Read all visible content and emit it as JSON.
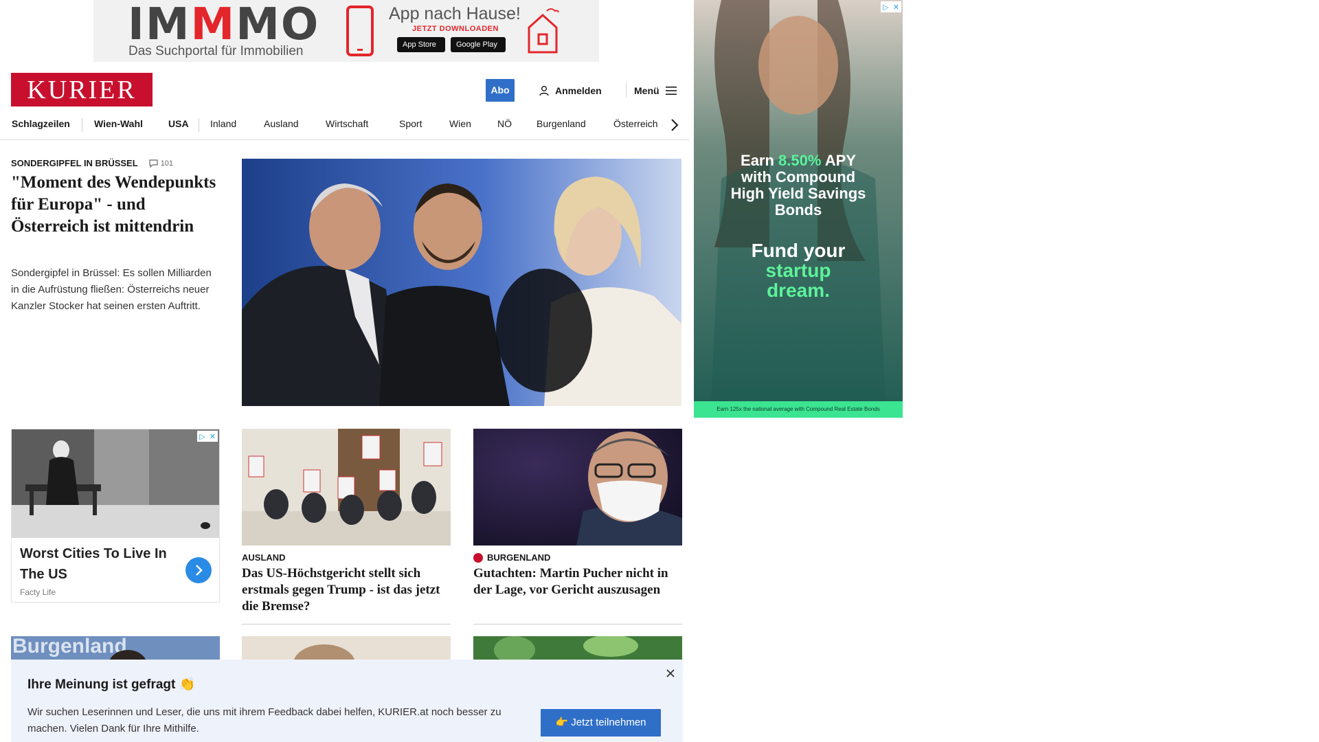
{
  "top_ad": {
    "brand_left": "IM",
    "brand_red": "M",
    "brand_right": "MO",
    "subtitle": "Das Suchportal für Immobilien",
    "claim": "App nach Hause!",
    "cta": "JETZT DOWNLOADEN",
    "store_apple": "App Store",
    "store_google": "Google Play"
  },
  "header": {
    "logo": "KURIER",
    "abo_label": "Abo",
    "login_label": "Anmelden",
    "menu_label": "Menü"
  },
  "nav": {
    "items": [
      "Schlagzeilen",
      "Wien-Wahl",
      "USA",
      "Inland",
      "Ausland",
      "Wirtschaft",
      "Sport",
      "Wien",
      "NÖ",
      "Burgenland",
      "Österreich"
    ]
  },
  "lead": {
    "kicker": "SONDERGIPFEL IN BRÜSSEL",
    "comments": "101",
    "title": "\"Moment des Wendepunkts für Europa\" - und Österreich ist mittendrin",
    "teaser": "Sondergipfel in Brüssel: Es sollen Milliarden in die Aufrüstung fließen: Österreichs neuer Kanzler Stocker hat seinen ersten Auftritt."
  },
  "native_ad": {
    "title": "Worst Cities To Live In The US",
    "source": "Facty Life"
  },
  "cards": [
    {
      "kicker": "AUSLAND",
      "title": "Das US-Höchstgericht stellt sich erstmals gegen Trump - ist das jetzt die Bremse?"
    },
    {
      "kicker": "BURGENLAND",
      "title": "Gutachten: Martin Pucher nicht in der Lage, vor Gericht auszusagen"
    }
  ],
  "thumb_text": "Burgenland",
  "side_ad": {
    "line1_a": "Earn ",
    "line1_green": "8.50%",
    "line1_b": " APY",
    "line2": "with Compound",
    "line3": "High Yield Savings",
    "line4": "Bonds",
    "fund_a": "Fund your",
    "fund_green_1": "startup",
    "fund_green_2": "dream.",
    "bar_text": "Earn 125x the national average with Compound Real Estate Bonds"
  },
  "survey": {
    "title": "Ihre Meinung ist gefragt 👏",
    "text": "Wir suchen Leserinnen und Leser, die uns mit ihrem Feedback dabei helfen, KURIER.at noch besser zu machen. Vielen Dank für Ihre Mithilfe.",
    "button": "👉 Jetzt teilnehmen"
  },
  "colors": {
    "brand_red": "#c8102e",
    "accent_blue": "#2f6fc8",
    "survey_bg": "#eef2fb",
    "ad_green": "#5df29a"
  }
}
